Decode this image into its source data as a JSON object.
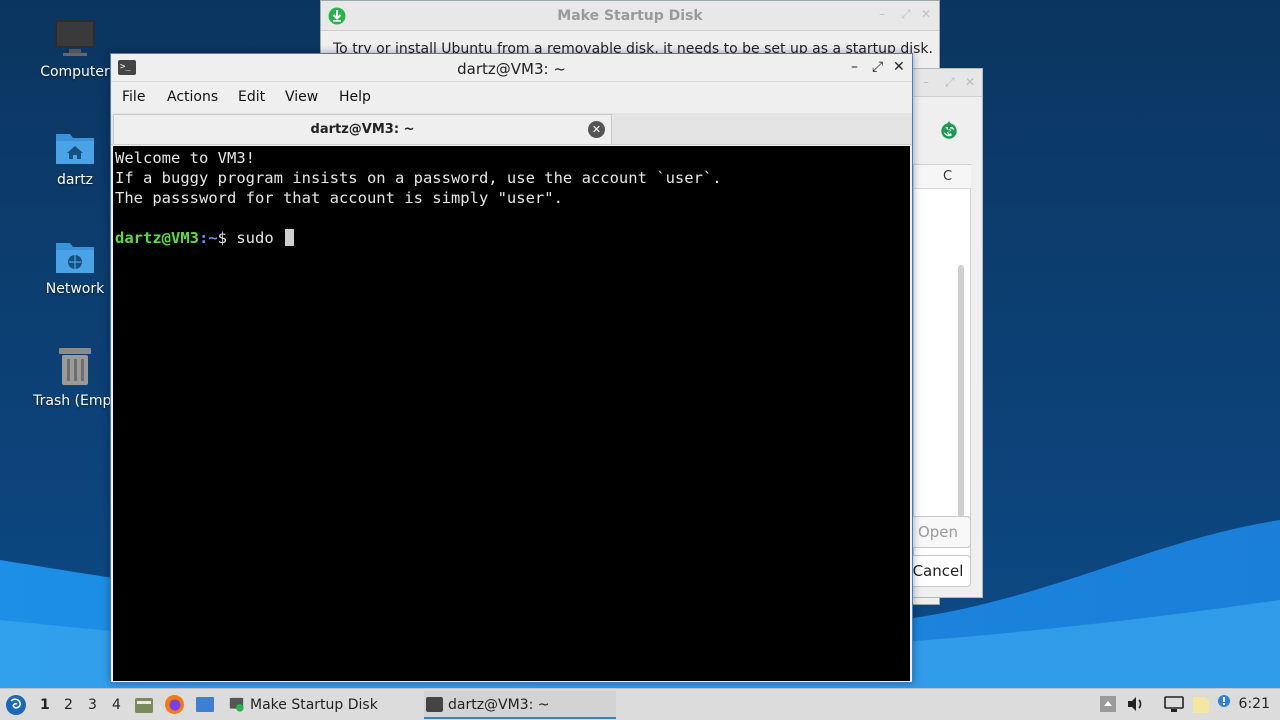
{
  "desktop": {
    "icons": [
      {
        "label": "Computer",
        "icon": "computer-icon"
      },
      {
        "label": "dartz",
        "icon": "home-folder-icon"
      },
      {
        "label": "Network",
        "icon": "network-folder-icon"
      },
      {
        "label": "Trash (Empt",
        "icon": "trash-icon"
      }
    ]
  },
  "startup_disk_window": {
    "title": "Make Startup Disk",
    "description": "To try or install Ubuntu from a removable disk, it needs to be set up as a startup disk."
  },
  "file_dialog": {
    "column_header": "C",
    "open_label": "Open",
    "cancel_label": "Cancel"
  },
  "terminal": {
    "title": "dartz@VM3: ~",
    "menu": [
      "File",
      "Actions",
      "Edit",
      "View",
      "Help"
    ],
    "tab_title": "dartz@VM3: ~",
    "lines": [
      "Welcome to VM3!",
      "If a buggy program insists on a password, use the account `user`.",
      "The passsword for that account is simply \"user\"."
    ],
    "prompt_user": "dartz@VM3",
    "prompt_path": ":~",
    "prompt_symbol": "$ ",
    "command": "sudo "
  },
  "taskbar": {
    "workspaces": [
      "1",
      "2",
      "3",
      "4"
    ],
    "active_workspace": "1",
    "tasks": [
      {
        "label": "Make Startup Disk",
        "icon": "startup-disk-icon"
      },
      {
        "label": "dartz@VM3: ~",
        "icon": "terminal-icon"
      }
    ],
    "clock": "6:21"
  },
  "colors": {
    "terminal_border": "#3e7fc8",
    "prompt_user": "#5ddc3f",
    "prompt_path": "#6f8bff"
  }
}
